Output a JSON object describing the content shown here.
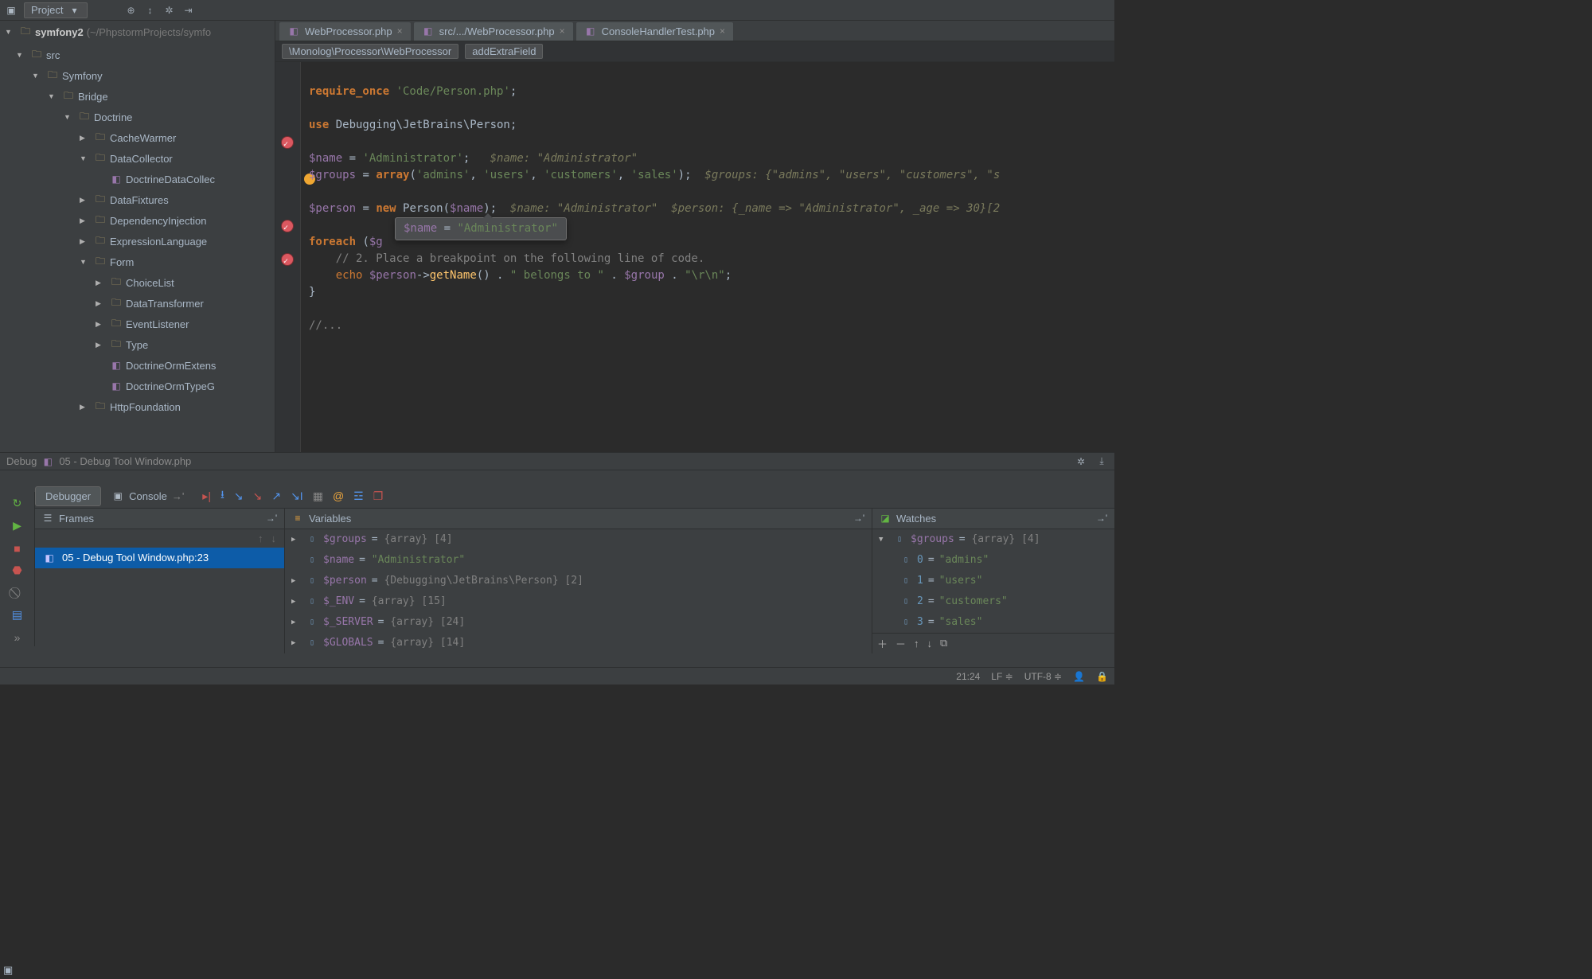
{
  "topbar": {
    "dropdown_label": "Project"
  },
  "project": {
    "root": "symfony2",
    "root_path": "(~/PhpstormProjects/symfo",
    "tree": [
      {
        "d": 1,
        "arrow": "▼",
        "type": "folder",
        "label": "src"
      },
      {
        "d": 2,
        "arrow": "▼",
        "type": "folder",
        "label": "Symfony"
      },
      {
        "d": 3,
        "arrow": "▼",
        "type": "folder",
        "label": "Bridge"
      },
      {
        "d": 4,
        "arrow": "▼",
        "type": "folder",
        "label": "Doctrine"
      },
      {
        "d": 5,
        "arrow": "▶",
        "type": "folder",
        "label": "CacheWarmer"
      },
      {
        "d": 5,
        "arrow": "▼",
        "type": "folder",
        "label": "DataCollector"
      },
      {
        "d": 6,
        "arrow": "",
        "type": "php",
        "label": "DoctrineDataCollec"
      },
      {
        "d": 5,
        "arrow": "▶",
        "type": "folder",
        "label": "DataFixtures"
      },
      {
        "d": 5,
        "arrow": "▶",
        "type": "folder",
        "label": "DependencyInjection"
      },
      {
        "d": 5,
        "arrow": "▶",
        "type": "folder",
        "label": "ExpressionLanguage"
      },
      {
        "d": 5,
        "arrow": "▼",
        "type": "folder",
        "label": "Form"
      },
      {
        "d": 6,
        "arrow": "▶",
        "type": "folder",
        "label": "ChoiceList"
      },
      {
        "d": 6,
        "arrow": "▶",
        "type": "folder",
        "label": "DataTransformer"
      },
      {
        "d": 6,
        "arrow": "▶",
        "type": "folder",
        "label": "EventListener"
      },
      {
        "d": 6,
        "arrow": "▶",
        "type": "folder",
        "label": "Type"
      },
      {
        "d": 6,
        "arrow": "",
        "type": "php",
        "label": "DoctrineOrmExtens"
      },
      {
        "d": 6,
        "arrow": "",
        "type": "php",
        "label": "DoctrineOrmTypeG"
      },
      {
        "d": 5,
        "arrow": "▶",
        "type": "folder",
        "label": "HttpFoundation"
      }
    ]
  },
  "tabs": [
    {
      "label": "WebProcessor.php",
      "active": true
    },
    {
      "label": "src/.../WebProcessor.php",
      "active": false
    },
    {
      "label": "ConsoleHandlerTest.php",
      "active": false
    }
  ],
  "breadcrumb": {
    "path": "\\Monolog\\Processor\\WebProcessor",
    "method": "addExtraField"
  },
  "editor": {
    "tooltip_var": "$name",
    "tooltip_val": "\"Administrator\"",
    "lines": {
      "l1a": "require_once ",
      "l1b": "'Code/Person.php'",
      "l1c": ";",
      "l2a": "use ",
      "l2b": "Debugging\\JetBrains\\Person;",
      "l3a": "$name",
      " l3b": " = ",
      "l3c": "'Administrator'",
      "l3d": ";   ",
      "l3h": "$name: \"Administrator\"",
      "l4a": "$groups",
      "l4b": " = ",
      "l4c": "array",
      "l4d": "(",
      "l4e": "'admins'",
      "l4f": ", ",
      "l4g": "'users'",
      "l4h": ", ",
      "l4i": "'customers'",
      "l4j": ", ",
      "l4k": "'sales'",
      "l4l": ");  ",
      "l4m": "$groups: {\"admins\", \"users\", \"customers\", \"s",
      "l5a": "$person",
      "l5b": " = ",
      "l5c": "new ",
      "l5d": "Person",
      "l5e": "(",
      "l5f": "$name",
      "l5g": ");  ",
      "l5h": "$name: \"Administrator\"  $person: {_name => \"Administrator\", _age => 30}[2",
      "l6a": "foreach ",
      "l6b": "(",
      "l6c": "$g",
      "l7a": "    // 2. Place a breakpoint on the following line of code.",
      "l8a": "    ",
      "l8b": "echo ",
      "l8c": "$person",
      "l8d": "->",
      "l8e": "getName",
      "l8f": "() . ",
      "l8g": "\" belongs to \"",
      "l8h": " . ",
      "l8i": "$group",
      "l8j": " . ",
      "l8k": "\"\\r\\n\"",
      "l8l": ";",
      "l9": "}",
      "l10": "//..."
    }
  },
  "debug": {
    "header": "Debug",
    "session": "05 - Debug Tool Window.php",
    "tab_debugger": "Debugger",
    "tab_console": "Console",
    "frames_title": "Frames",
    "variables_title": "Variables",
    "watches_title": "Watches",
    "frame": "05 - Debug Tool Window.php:23",
    "vars": [
      {
        "arrow": "▶",
        "name": "$groups",
        "rest": " = {array} [4]"
      },
      {
        "arrow": "",
        "name": "$name",
        "rest": " = \"Administrator\"",
        "str": true
      },
      {
        "arrow": "▶",
        "name": "$person",
        "rest": " = {Debugging\\JetBrains\\Person} [2]"
      },
      {
        "arrow": "▶",
        "name": "$_ENV",
        "rest": " = {array} [15]"
      },
      {
        "arrow": "▶",
        "name": "$_SERVER",
        "rest": " = {array} [24]"
      },
      {
        "arrow": "▶",
        "name": "$GLOBALS",
        "rest": " = {array} [14]"
      }
    ],
    "watches": {
      "root": {
        "name": "$groups",
        "rest": " = {array} [4]"
      },
      "items": [
        {
          "k": "0",
          "v": "\"admins\""
        },
        {
          "k": "1",
          "v": "\"users\""
        },
        {
          "k": "2",
          "v": "\"customers\""
        },
        {
          "k": "3",
          "v": "\"sales\""
        }
      ]
    }
  },
  "status": {
    "pos": "21:24",
    "le": "LF ≑",
    "enc": "UTF-8 ≑"
  }
}
